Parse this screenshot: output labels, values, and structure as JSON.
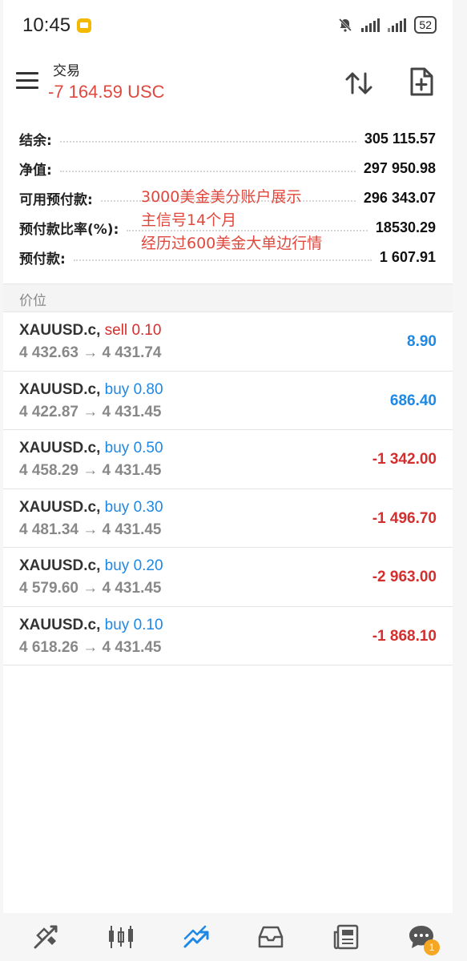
{
  "status_bar": {
    "time": "10:45",
    "battery": "52"
  },
  "header": {
    "title": "交易",
    "profit": "-7 164.59 USC"
  },
  "summary": {
    "rows": [
      {
        "label": "结余:",
        "value": "305 115.57"
      },
      {
        "label": "净值:",
        "value": "297 950.98"
      },
      {
        "label": "可用预付款:",
        "value": "296 343.07"
      },
      {
        "label": "预付款比率(%):",
        "value": "18530.29"
      },
      {
        "label": "预付款:",
        "value": "1 607.91"
      }
    ]
  },
  "overlay": {
    "lines": [
      "3000美金美分账户展示",
      "主信号14个月",
      "经历过600美金大单边行情"
    ]
  },
  "section": {
    "label": "价位"
  },
  "positions": [
    {
      "symbol": "XAUUSD.c,",
      "side": "sell",
      "volume": "0.10",
      "prices": "4 432.63 → 4 431.74",
      "profit": "8.90"
    },
    {
      "symbol": "XAUUSD.c,",
      "side": "buy",
      "volume": "0.80",
      "prices": "4 422.87 → 4 431.45",
      "profit": "686.40"
    },
    {
      "symbol": "XAUUSD.c,",
      "side": "buy",
      "volume": "0.50",
      "prices": "4 458.29 → 4 431.45",
      "profit": "-1 342.00"
    },
    {
      "symbol": "XAUUSD.c,",
      "side": "buy",
      "volume": "0.30",
      "prices": "4 481.34 → 4 431.45",
      "profit": "-1 496.70"
    },
    {
      "symbol": "XAUUSD.c,",
      "side": "buy",
      "volume": "0.20",
      "prices": "4 579.60 → 4 431.45",
      "profit": "-2 963.00"
    },
    {
      "symbol": "XAUUSD.c,",
      "side": "buy",
      "volume": "0.10",
      "prices": "4 618.26 → 4 431.45",
      "profit": "-1 868.10"
    }
  ],
  "bottom_nav": {
    "items": [
      {
        "icon": "quotes-icon"
      },
      {
        "icon": "chart-icon"
      },
      {
        "icon": "trade-icon",
        "active": true
      },
      {
        "icon": "history-icon"
      },
      {
        "icon": "news-icon"
      },
      {
        "icon": "messages-icon",
        "badge": "1"
      }
    ]
  },
  "colors": {
    "accent": "#1e88e5",
    "negative": "#d32f2f",
    "header_profit": "#e0483e"
  }
}
